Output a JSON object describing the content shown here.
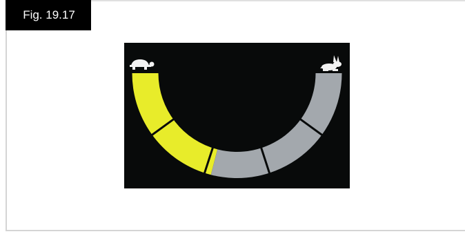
{
  "figure": {
    "label": "Fig. 19.17"
  },
  "speed_gauge": {
    "segments_total": 5,
    "level_fraction": 0.42,
    "active_color": "#e8ec2a",
    "inactive_color": "#a3a8ad",
    "background_color": "#080a0a",
    "left_icon": "tortoise-icon",
    "right_icon": "hare-icon"
  }
}
